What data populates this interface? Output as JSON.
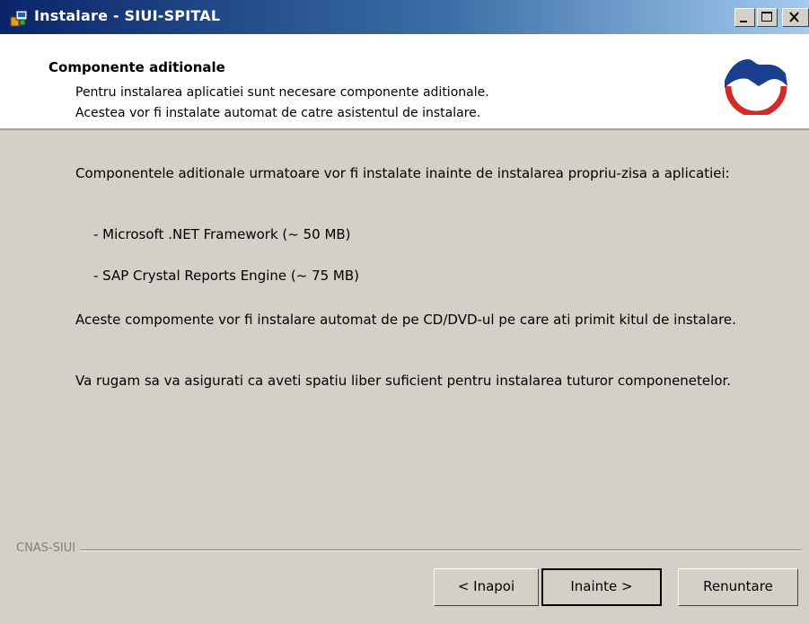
{
  "window": {
    "title": "Instalare - SIUI-SPITAL",
    "icons": {
      "app": "installer-app-icon",
      "minimize": "minimize-icon",
      "maximize": "maximize-icon",
      "close": "close-icon"
    }
  },
  "header": {
    "title": "Componente aditionale",
    "line1": "Pentru instalarea aplicatiei sunt necesare componente aditionale.",
    "line2": "Acestea vor fi instalate automat de catre asistentul de instalare.",
    "logo_icon": "cnas-logo-icon",
    "colors": {
      "logo_blue": "#1b3f8f",
      "logo_red": "#d42a2a"
    }
  },
  "content": {
    "para1": "Componentele aditionale urmatoare vor fi instalate inainte de instalarea propriu-zisa a aplicatiei:",
    "item1": "- Microsoft .NET Framework (~ 50 MB)",
    "item2": "- SAP Crystal Reports Engine (~ 75 MB)",
    "para2": "Aceste compomente vor fi instalare automat de pe CD/DVD-ul pe care ati primit kitul de instalare.",
    "para3": "Va rugam sa va asigurati ca aveti spatiu liber suficient pentru instalarea tuturor componenetelor."
  },
  "footer": {
    "group_label": "CNAS-SIUI",
    "back_label": "< Inapoi",
    "next_label": "Inainte >",
    "cancel_label": "Renuntare"
  }
}
